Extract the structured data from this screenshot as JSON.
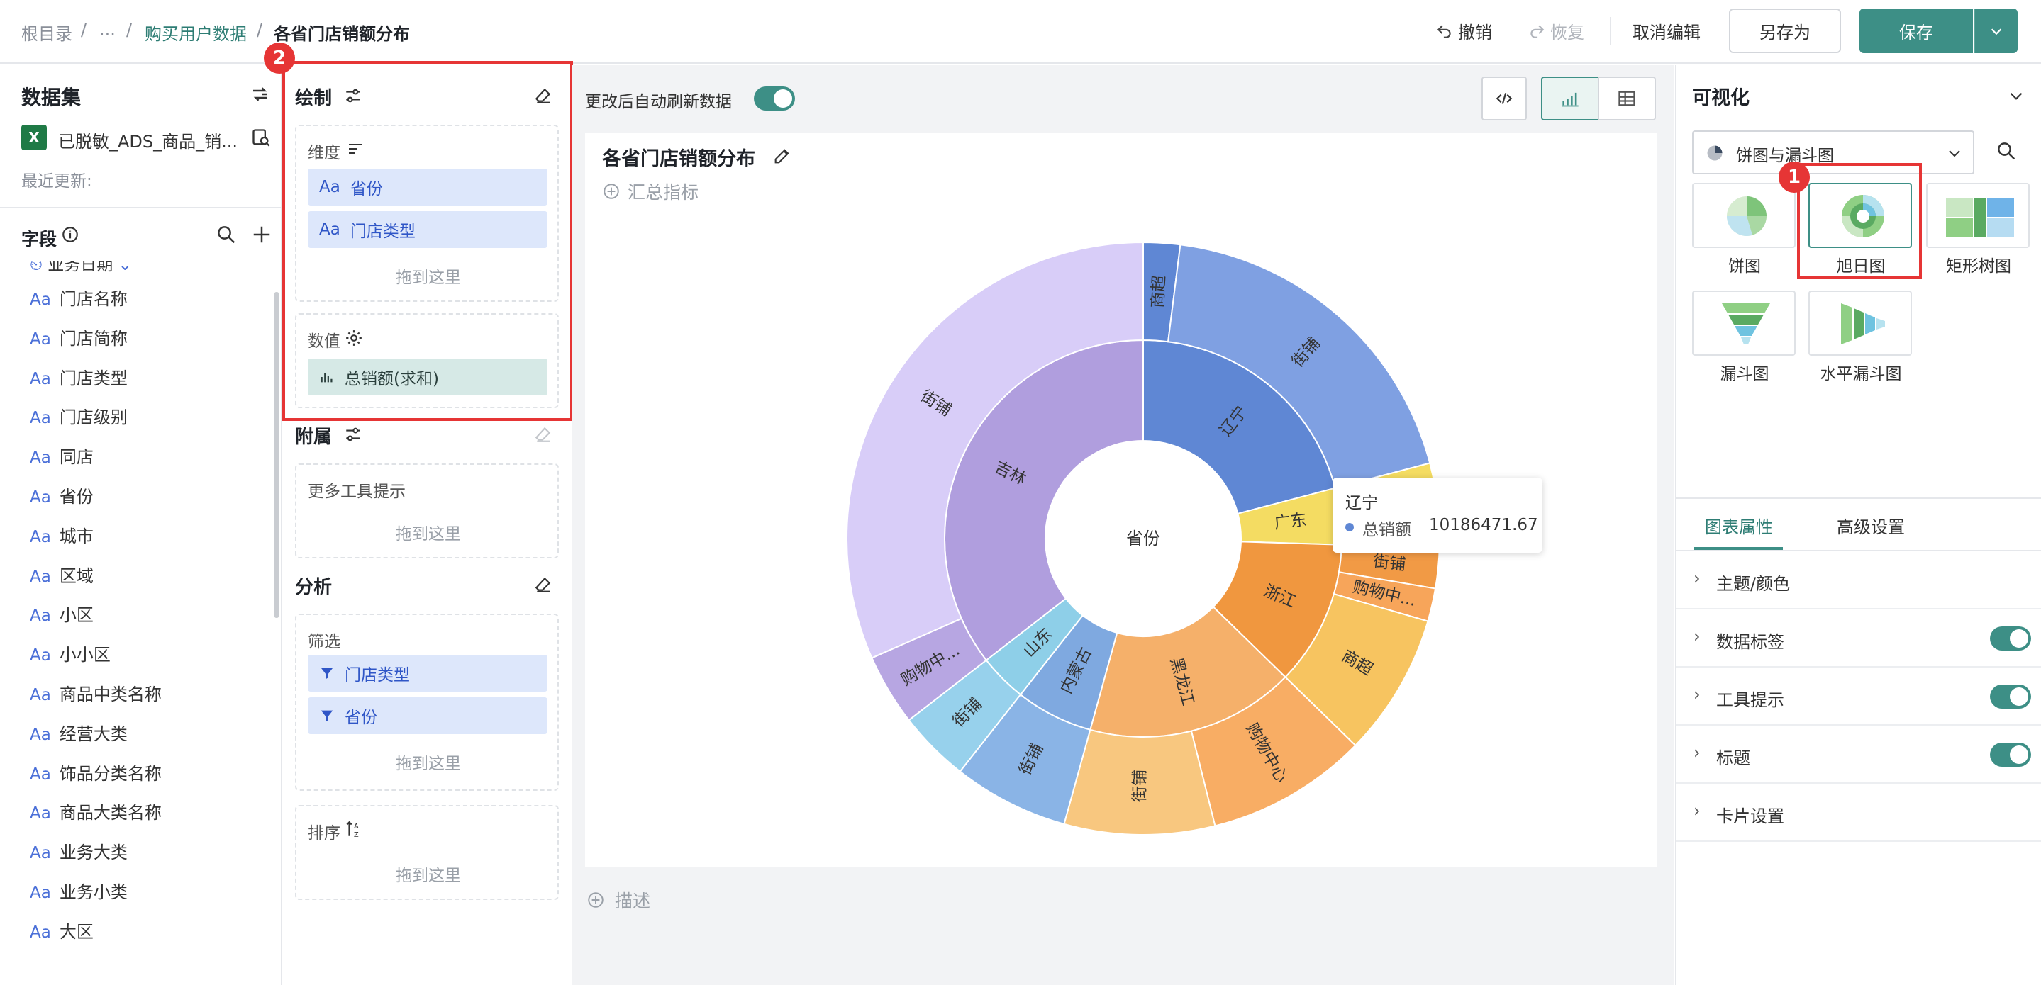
{
  "breadcrumb": {
    "root": "根目录",
    "sep": "/",
    "ellipsis": "...",
    "parent": "购买用户数据",
    "current": "各省门店销额分布"
  },
  "toolbar": {
    "undo": "撤销",
    "redo": "恢复",
    "cancel_edit": "取消编辑",
    "save_as": "另存为",
    "save": "保存"
  },
  "dataset": {
    "title": "数据集",
    "name": "已脱敏_ADS_商品_销...",
    "updated_label": "最近更新:"
  },
  "fields": {
    "title": "字段",
    "partial_item": "业务日期",
    "items": [
      "门店名称",
      "门店简称",
      "门店类型",
      "门店级别",
      "同店",
      "省份",
      "城市",
      "区域",
      "小区",
      "小小区",
      "商品中类名称",
      "经营大类",
      "饰品分类名称",
      "商品大类名称",
      "业务大类",
      "业务小类",
      "大区"
    ],
    "type_prefix": "Aa"
  },
  "config": {
    "draw_title": "绘制",
    "dimension_label": "维度",
    "dimension_pills": [
      "省份",
      "门店类型"
    ],
    "value_label": "数值",
    "value_pill": "总销额(求和)",
    "drop_here": "拖到这里",
    "attach_title": "附属",
    "more_tooltip": "更多工具提示",
    "analysis_title": "分析",
    "filter_label": "筛选",
    "filter_pills": [
      "门店类型",
      "省份"
    ],
    "sort_label": "排序"
  },
  "chart_toolbar": {
    "auto_refresh": "更改后自动刷新数据",
    "auto_refresh_on": true
  },
  "chart_card": {
    "title": "各省门店销额分布",
    "add_metric": "汇总指标",
    "describe": "描述"
  },
  "tooltip": {
    "title": "辽宁",
    "metric": "总销额",
    "value": "10186471.67"
  },
  "chart_data": {
    "type": "sunburst",
    "center_label": "省份",
    "inner": [
      {
        "name": "辽宁",
        "value": 20.9,
        "color": "#5f87d4"
      },
      {
        "name": "广东",
        "value": 4.6,
        "color": "#f4dc62"
      },
      {
        "name": "浙江",
        "value": 11.8,
        "color": "#f0973f"
      },
      {
        "name": "黑龙江",
        "value": 17.0,
        "color": "#f5b06a"
      },
      {
        "name": "内蒙古",
        "value": 6.3,
        "color": "#7fa9e0"
      },
      {
        "name": "山东",
        "value": 3.9,
        "color": "#8ecfe8"
      },
      {
        "name": "吉林",
        "value": 35.5,
        "color": "#b09ede"
      }
    ],
    "outer": [
      {
        "name": "商超",
        "parent": "辽宁",
        "value": 2.0,
        "color": "#5f87d4"
      },
      {
        "name": "街铺",
        "parent": "辽宁",
        "value": 18.9,
        "color": "#7fa0e2"
      },
      {
        "name": "",
        "parent": "广东",
        "value": 1.3,
        "color": "#f4dc62"
      },
      {
        "name": "街铺",
        "parent": "广东",
        "value": 3.3,
        "color": "#fff38a"
      },
      {
        "name": "街铺",
        "parent": "浙江",
        "value": 2.2,
        "color": "#f19a45"
      },
      {
        "name": "购物中...",
        "parent": "浙江",
        "value": 1.8,
        "color": "#f7a55a"
      },
      {
        "name": "商超",
        "parent": "浙江",
        "value": 7.8,
        "color": "#f7c460"
      },
      {
        "name": "购物中心",
        "parent": "黑龙江",
        "value": 8.8,
        "color": "#f8ad64"
      },
      {
        "name": "街铺",
        "parent": "黑龙江",
        "value": 8.2,
        "color": "#f8c77f"
      },
      {
        "name": "街铺",
        "parent": "内蒙古",
        "value": 6.3,
        "color": "#8ab4e6"
      },
      {
        "name": "街铺",
        "parent": "山东",
        "value": 3.9,
        "color": "#97d1ec"
      },
      {
        "name": "购物中...",
        "parent": "吉林",
        "value": 3.9,
        "color": "#b7a6e2"
      },
      {
        "name": "街铺",
        "parent": "吉林",
        "value": 31.6,
        "color": "#d8cdf8"
      }
    ]
  },
  "visualization": {
    "title": "可视化",
    "selected_group": "饼图与漏斗图",
    "types": [
      "饼图",
      "旭日图",
      "矩形树图",
      "漏斗图",
      "水平漏斗图"
    ],
    "selected_type": "旭日图"
  },
  "props": {
    "tabs": [
      "图表属性",
      "高级设置"
    ],
    "rows": [
      {
        "label": "主题/颜色",
        "toggle": false
      },
      {
        "label": "数据标签",
        "toggle": true
      },
      {
        "label": "工具提示",
        "toggle": true
      },
      {
        "label": "标题",
        "toggle": true
      },
      {
        "label": "卡片设置",
        "toggle": false
      }
    ]
  },
  "annotations": {
    "badge1": "1",
    "badge2": "2"
  }
}
